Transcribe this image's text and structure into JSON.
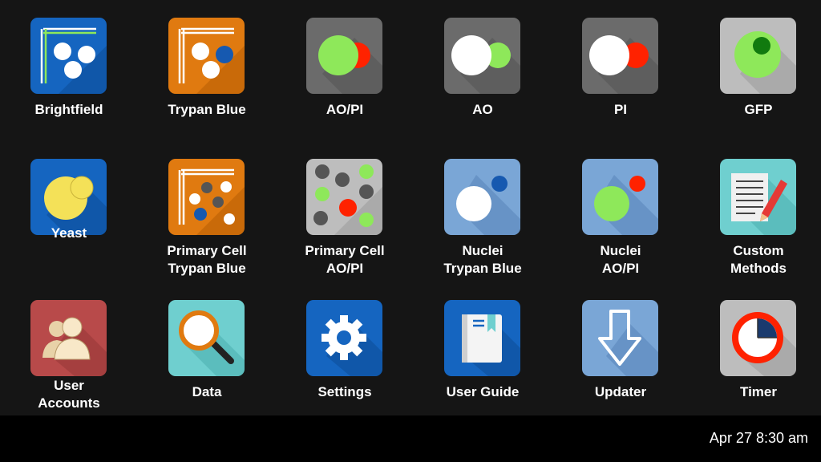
{
  "apps": [
    {
      "name": "brightfield",
      "label": "Brightfield",
      "icon": "brightfield-icon"
    },
    {
      "name": "trypan-blue",
      "label": "Trypan Blue",
      "icon": "trypan-blue-icon"
    },
    {
      "name": "ao-pi",
      "label": "AO/PI",
      "icon": "ao-pi-icon"
    },
    {
      "name": "ao",
      "label": "AO",
      "icon": "ao-icon"
    },
    {
      "name": "pi",
      "label": "PI",
      "icon": "pi-icon"
    },
    {
      "name": "gfp",
      "label": "GFP",
      "icon": "gfp-icon"
    },
    {
      "name": "yeast",
      "label": "Yeast",
      "icon": "yeast-icon"
    },
    {
      "name": "primary-cell-trypan-blue",
      "label": "Primary Cell\nTrypan Blue",
      "icon": "primary-cell-trypan-blue-icon"
    },
    {
      "name": "primary-cell-ao-pi",
      "label": "Primary Cell\nAO/PI",
      "icon": "primary-cell-ao-pi-icon"
    },
    {
      "name": "nuclei-trypan-blue",
      "label": "Nuclei\nTrypan Blue",
      "icon": "nuclei-trypan-blue-icon"
    },
    {
      "name": "nuclei-ao-pi",
      "label": "Nuclei\nAO/PI",
      "icon": "nuclei-ao-pi-icon"
    },
    {
      "name": "custom-methods",
      "label": "Custom\nMethods",
      "icon": "notepad-pencil-icon"
    },
    {
      "name": "user-accounts",
      "label": "User\nAccounts",
      "icon": "users-icon"
    },
    {
      "name": "data",
      "label": "Data",
      "icon": "magnifier-icon"
    },
    {
      "name": "settings",
      "label": "Settings",
      "icon": "gear-icon"
    },
    {
      "name": "user-guide",
      "label": "User Guide",
      "icon": "book-icon"
    },
    {
      "name": "updater",
      "label": "Updater",
      "icon": "download-arrow-icon"
    },
    {
      "name": "timer",
      "label": "Timer",
      "icon": "timer-icon"
    }
  ],
  "colors": {
    "background": "#151515",
    "taskbar": "#000000",
    "blue_tile": "#1565c0",
    "orange_tile": "#e07a10",
    "gray_tile": "#6b6b6b",
    "light_gray_tile": "#bdbdbd",
    "light_blue_tile": "#7aa6d6",
    "teal_tile": "#6fcfcf",
    "red_tile": "#b84a4a",
    "green_dot": "#8ee85a",
    "red_dot": "#ff2200"
  },
  "taskbar": {
    "clock": "Apr 27 8:30 am"
  }
}
